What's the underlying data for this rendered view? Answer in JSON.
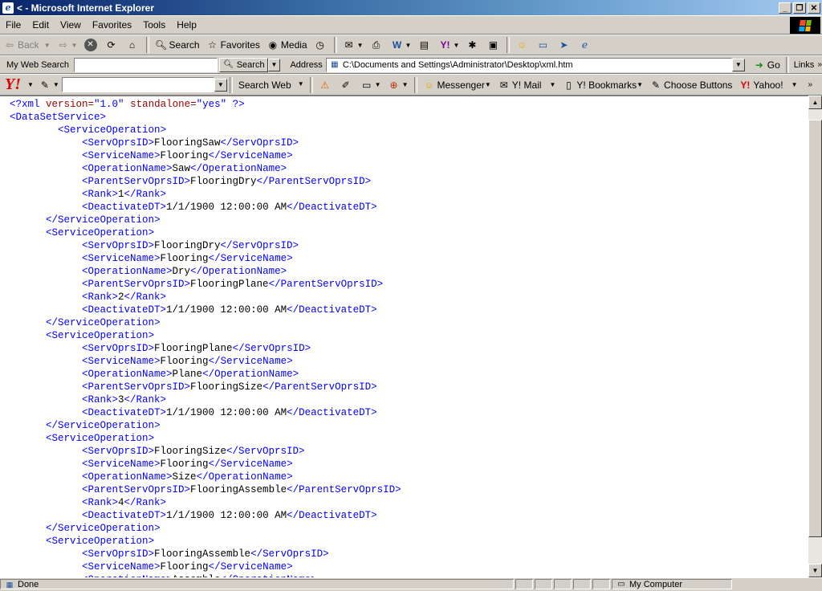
{
  "window": {
    "title": "< - Microsoft Internet Explorer"
  },
  "menu": [
    "File",
    "Edit",
    "View",
    "Favorites",
    "Tools",
    "Help"
  ],
  "toolbar": {
    "back": "Back",
    "search": "Search",
    "favorites": "Favorites",
    "media": "Media"
  },
  "mywebsearch": {
    "label": "My Web Search",
    "button": "Search",
    "value": ""
  },
  "address": {
    "label": "Address",
    "value": "C:\\Documents and Settings\\Administrator\\Desktop\\xml.htm",
    "go": "Go",
    "links": "Links"
  },
  "yahoo": {
    "logo": "Y!",
    "search_web": "Search Web",
    "messenger": "Messenger",
    "mail": "Y! Mail",
    "bookmarks": "Y! Bookmarks",
    "choose": "Choose Buttons",
    "yahoo_link": "Yahoo!"
  },
  "xml": {
    "declaration": {
      "open": "<?xml",
      "version_attr": "version=",
      "version_val": "\"1.0\"",
      "standalone_attr": "standalone=",
      "standalone_val": "\"yes\"",
      "close": "?>"
    },
    "root": "DataSetService",
    "item_tag": "ServiceOperation",
    "operations": [
      {
        "ServOprsID": "FlooringSaw",
        "ServiceName": "Flooring",
        "OperationName": "Saw",
        "ParentServOprsID": "FlooringDry",
        "Rank": "1",
        "DeactivateDT": "1/1/1900 12:00:00 AM"
      },
      {
        "ServOprsID": "FlooringDry",
        "ServiceName": "Flooring",
        "OperationName": "Dry",
        "ParentServOprsID": "FlooringPlane",
        "Rank": "2",
        "DeactivateDT": "1/1/1900 12:00:00 AM"
      },
      {
        "ServOprsID": "FlooringPlane",
        "ServiceName": "Flooring",
        "OperationName": "Plane",
        "ParentServOprsID": "FlooringSize",
        "Rank": "3",
        "DeactivateDT": "1/1/1900 12:00:00 AM"
      },
      {
        "ServOprsID": "FlooringSize",
        "ServiceName": "Flooring",
        "OperationName": "Size",
        "ParentServOprsID": "FlooringAssemble",
        "Rank": "4",
        "DeactivateDT": "1/1/1900 12:00:00 AM"
      },
      {
        "ServOprsID": "FlooringAssemble",
        "ServiceName": "Flooring",
        "OperationName": "Assemble"
      }
    ]
  },
  "status": {
    "text": "Done",
    "zone": "My Computer"
  }
}
